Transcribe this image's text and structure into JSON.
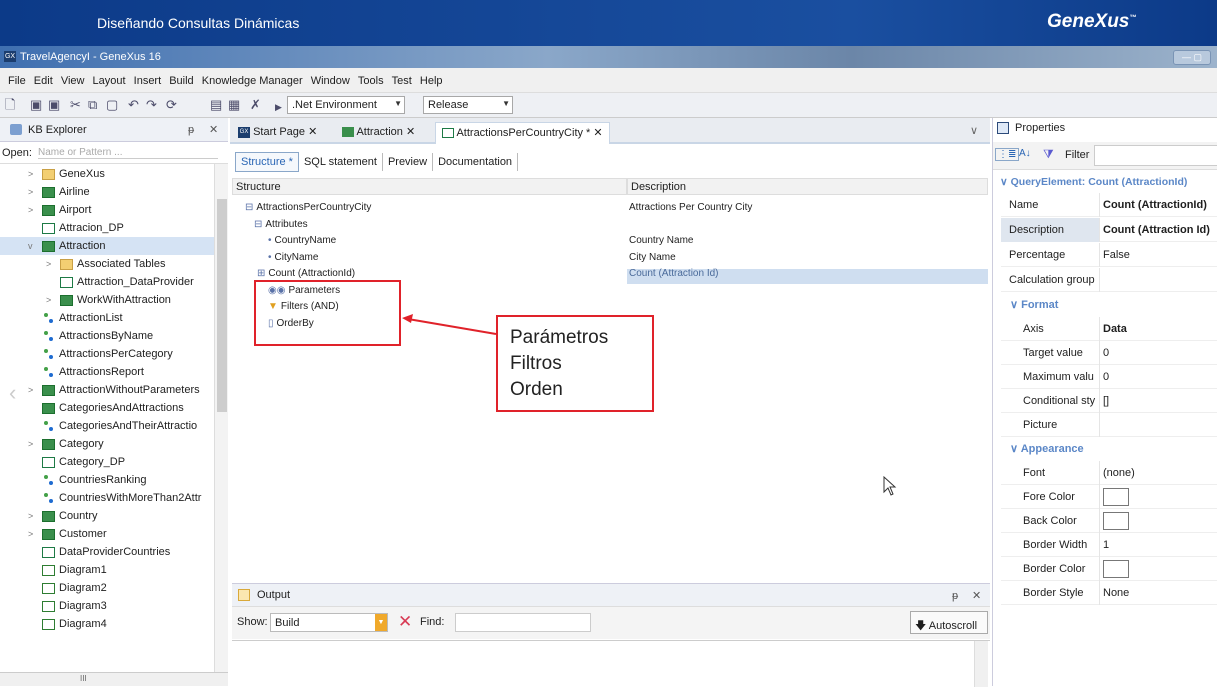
{
  "banner": {
    "title": "Diseñando Consultas Dinámicas",
    "logo": "GeneXus",
    "logo_tm": "™"
  },
  "window": {
    "title": "TravelAgencyI - GeneXus 16",
    "icon": "GX",
    "controls": "— ▢"
  },
  "menu": [
    "File",
    "Edit",
    "View",
    "Layout",
    "Insert",
    "Build",
    "Knowledge Manager",
    "Window",
    "Tools",
    "Test",
    "Help"
  ],
  "toolbar": {
    "environment": ".Net Environment",
    "configuration": "Release"
  },
  "kb": {
    "title": "KB Explorer",
    "pin": "ᵽ",
    "close": "✕",
    "open_label": "Open:",
    "open_placeholder": "Name or Pattern ...",
    "items": [
      {
        "label": "GeneXus",
        "icon": "folder",
        "indent": 1,
        "expand": ">"
      },
      {
        "label": "Airline",
        "icon": "trn",
        "indent": 1,
        "expand": ">"
      },
      {
        "label": "Airport",
        "icon": "trn",
        "indent": 1,
        "expand": ">"
      },
      {
        "label": "Attracion_DP",
        "icon": "dp",
        "indent": 1,
        "expand": ""
      },
      {
        "label": "Attraction",
        "icon": "trn",
        "indent": 1,
        "expand": "v",
        "selected": true
      },
      {
        "label": "Associated Tables",
        "icon": "folder",
        "indent": 2,
        "expand": ">"
      },
      {
        "label": "Attraction_DataProvider",
        "icon": "dp",
        "indent": 2,
        "expand": ""
      },
      {
        "label": "WorkWithAttraction",
        "icon": "trn",
        "indent": 2,
        "expand": ">"
      },
      {
        "label": "AttractionList",
        "icon": "proc",
        "indent": 1,
        "expand": ""
      },
      {
        "label": "AttractionsByName",
        "icon": "proc",
        "indent": 1,
        "expand": ""
      },
      {
        "label": "AttractionsPerCategory",
        "icon": "proc",
        "indent": 1,
        "expand": ""
      },
      {
        "label": "AttractionsReport",
        "icon": "proc",
        "indent": 1,
        "expand": ""
      },
      {
        "label": "AttractionWithoutParameters",
        "icon": "trn",
        "indent": 1,
        "expand": ">"
      },
      {
        "label": "CategoriesAndAttractions",
        "icon": "trn",
        "indent": 1,
        "expand": ""
      },
      {
        "label": "CategoriesAndTheirAttractio",
        "icon": "proc",
        "indent": 1,
        "expand": ""
      },
      {
        "label": "Category",
        "icon": "trn",
        "indent": 1,
        "expand": ">"
      },
      {
        "label": "Category_DP",
        "icon": "dp",
        "indent": 1,
        "expand": ""
      },
      {
        "label": "CountriesRanking",
        "icon": "proc",
        "indent": 1,
        "expand": ""
      },
      {
        "label": "CountriesWithMoreThan2Attr",
        "icon": "proc",
        "indent": 1,
        "expand": ""
      },
      {
        "label": "Country",
        "icon": "trn",
        "indent": 1,
        "expand": ">"
      },
      {
        "label": "Customer",
        "icon": "trn",
        "indent": 1,
        "expand": ">"
      },
      {
        "label": "DataProviderCountries",
        "icon": "dp",
        "indent": 1,
        "expand": ""
      },
      {
        "label": "Diagram1",
        "icon": "diag",
        "indent": 1,
        "expand": ""
      },
      {
        "label": "Diagram2",
        "icon": "diag",
        "indent": 1,
        "expand": ""
      },
      {
        "label": "Diagram3",
        "icon": "diag",
        "indent": 1,
        "expand": ""
      },
      {
        "label": "Diagram4",
        "icon": "diag",
        "indent": 1,
        "expand": ""
      }
    ],
    "scroll_label": "III"
  },
  "tabs": [
    {
      "label": "Start Page",
      "icon": "GX"
    },
    {
      "label": "Attraction",
      "icon": "trn"
    },
    {
      "label": "AttractionsPerCountryCity *",
      "icon": "dp",
      "active": true
    }
  ],
  "subtabs": [
    "Structure *",
    "SQL statement",
    "Preview",
    "Documentation"
  ],
  "grid": {
    "col_structure": "Structure",
    "col_description": "Description",
    "rows": [
      {
        "name": "AttractionsPerCountryCity",
        "desc": "Attractions Per Country City",
        "prefix": "⊟"
      },
      {
        "name": "Attributes",
        "desc": "",
        "prefix": "⊟"
      },
      {
        "name": "CountryName",
        "desc": "Country Name",
        "prefix": "•"
      },
      {
        "name": "CityName",
        "desc": "City Name",
        "prefix": "•"
      },
      {
        "name": "Count (AttractionId)",
        "desc": "Count (Attraction Id)",
        "prefix": "⊞"
      },
      {
        "name": "Parameters",
        "desc": "",
        "prefix": "◉◉"
      },
      {
        "name": "Filters (AND)",
        "desc": "",
        "prefix": "▼"
      },
      {
        "name": "OrderBy",
        "desc": "",
        "prefix": "▯"
      }
    ]
  },
  "callout": [
    "Parámetros",
    "Filtros",
    "Orden"
  ],
  "output": {
    "title": "Output",
    "show_label": "Show:",
    "show_value": "Build",
    "find_label": "Find:",
    "autoscroll": "Autoscroll",
    "pin": "ᵽ",
    "close": "✕"
  },
  "props": {
    "title": "Properties",
    "filter": "Filter",
    "element": "QueryElement: Count (AttractionId)",
    "rows": [
      {
        "k": "Name",
        "v": "Count (AttractionId)",
        "bold": true
      },
      {
        "k": "Description",
        "v": "Count (Attraction Id)",
        "bold": true,
        "hl": true
      },
      {
        "k": "Percentage",
        "v": "False"
      },
      {
        "k": "Calculation group",
        "v": ""
      }
    ],
    "format_label": "Format",
    "format_rows": [
      {
        "k": "Axis",
        "v": "Data",
        "bold": true
      },
      {
        "k": "Target value",
        "v": "0"
      },
      {
        "k": "Maximum valu",
        "v": "0"
      },
      {
        "k": "Conditional sty",
        "v": "[]"
      },
      {
        "k": "Picture",
        "v": ""
      }
    ],
    "appearance_label": "Appearance",
    "appearance_rows": [
      {
        "k": "Font",
        "v": "(none)"
      },
      {
        "k": "Fore Color",
        "v": "",
        "swatch": true
      },
      {
        "k": "Back Color",
        "v": "",
        "swatch": true
      },
      {
        "k": "Border Width",
        "v": "1"
      },
      {
        "k": "Border Color",
        "v": "",
        "swatch": true
      },
      {
        "k": "Border Style",
        "v": "None"
      }
    ]
  }
}
